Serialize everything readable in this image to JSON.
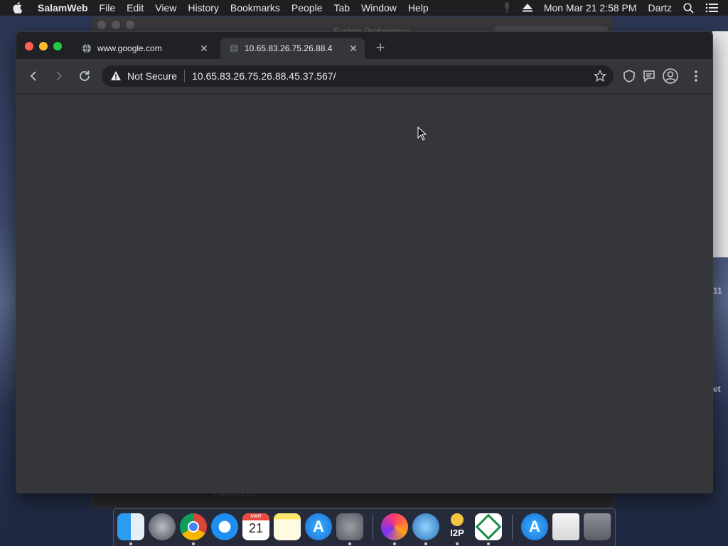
{
  "menubar": {
    "app_name": "SalamWeb",
    "items": [
      "File",
      "Edit",
      "View",
      "History",
      "Bookmarks",
      "People",
      "Tab",
      "Window",
      "Help"
    ],
    "clock": "Mon Mar 21  2:58 PM",
    "user": "Dartz"
  },
  "background_window": {
    "title": "System Preferences",
    "footer": "Preferences"
  },
  "desktop": {
    "edge_text_1": "11",
    "edge_text_2": "et"
  },
  "browser": {
    "tabs": [
      {
        "title": "www.google.com",
        "active": false
      },
      {
        "title": "10.65.83.26.75.26.88.4",
        "active": true
      }
    ],
    "omnibox": {
      "security_label": "Not Secure",
      "url": "10.65.83.26.75.26.88.45.37.567/"
    }
  },
  "dock": {
    "calendar_month": "MAR",
    "calendar_day": "21",
    "i2p_label": "I2P"
  },
  "colors": {
    "window_bg": "#35363a",
    "tabstrip_bg": "#202124",
    "menubar_bg": "#1f1f22"
  }
}
